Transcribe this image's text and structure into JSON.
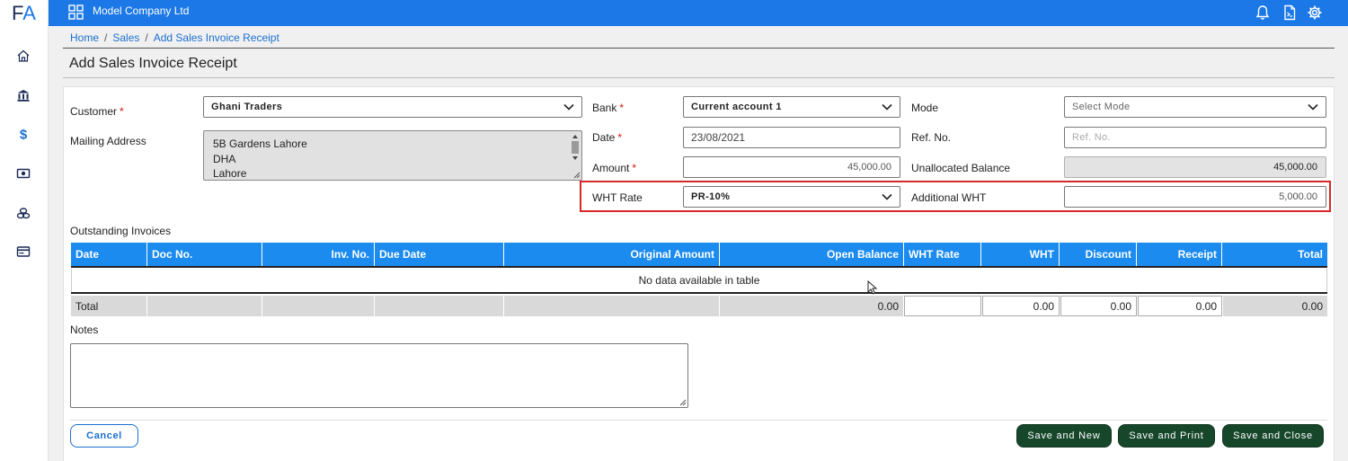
{
  "app": {
    "logo_f": "F",
    "logo_a": "A",
    "company": "Model Company Ltd"
  },
  "rail": {
    "icons": [
      "home-icon",
      "bank-icon",
      "dollar-icon",
      "cash-icon",
      "coins-icon",
      "card-icon"
    ]
  },
  "topbar": {
    "icons": [
      "bell-icon",
      "document-icon",
      "gear-icon"
    ]
  },
  "breadcrumb": {
    "home": "Home",
    "sales": "Sales",
    "current": "Add Sales Invoice Receipt",
    "sep": "/"
  },
  "page": {
    "title": "Add Sales Invoice Receipt"
  },
  "form": {
    "customer_label": "Customer",
    "customer_value": "Ghani Traders",
    "mailing_label": "Mailing Address",
    "mailing_lines": [
      "5B Gardens Lahore",
      "DHA",
      "Lahore"
    ],
    "bank_label": "Bank",
    "bank_value": "Current account 1",
    "date_label": "Date",
    "date_value": "23/08/2021",
    "amount_label": "Amount",
    "amount_value": "45,000.00",
    "wht_rate_label": "WHT Rate",
    "wht_rate_value": "PR-10%",
    "mode_label": "Mode",
    "mode_placeholder": "Select Mode",
    "ref_label": "Ref. No.",
    "ref_placeholder": "Ref. No.",
    "unalloc_label": "Unallocated Balance",
    "unalloc_value": "45,000.00",
    "add_wht_label": "Additional WHT",
    "add_wht_value": "5,000.00",
    "required_mark": "*"
  },
  "outstanding": {
    "title": "Outstanding Invoices",
    "columns": [
      "Date",
      "Doc No.",
      "Inv. No.",
      "Due Date",
      "Original Amount",
      "Open Balance",
      "WHT Rate",
      "WHT",
      "Discount",
      "Receipt",
      "Total"
    ],
    "no_data": "No data available in table",
    "total_label": "Total",
    "totals": {
      "open_balance": "0.00",
      "wht": "0.00",
      "discount": "0.00",
      "receipt": "0.00",
      "total": "0.00"
    }
  },
  "notes": {
    "label": "Notes",
    "value": ""
  },
  "buttons": {
    "cancel": "Cancel",
    "save_new": "Save and New",
    "save_print": "Save and Print",
    "save_close": "Save and Close"
  },
  "colors": {
    "brand": "#1b78e6",
    "table_header": "#1b8bf0",
    "save_buttons": "#17472b",
    "highlight": "#d62828",
    "required": "#dd1111"
  }
}
